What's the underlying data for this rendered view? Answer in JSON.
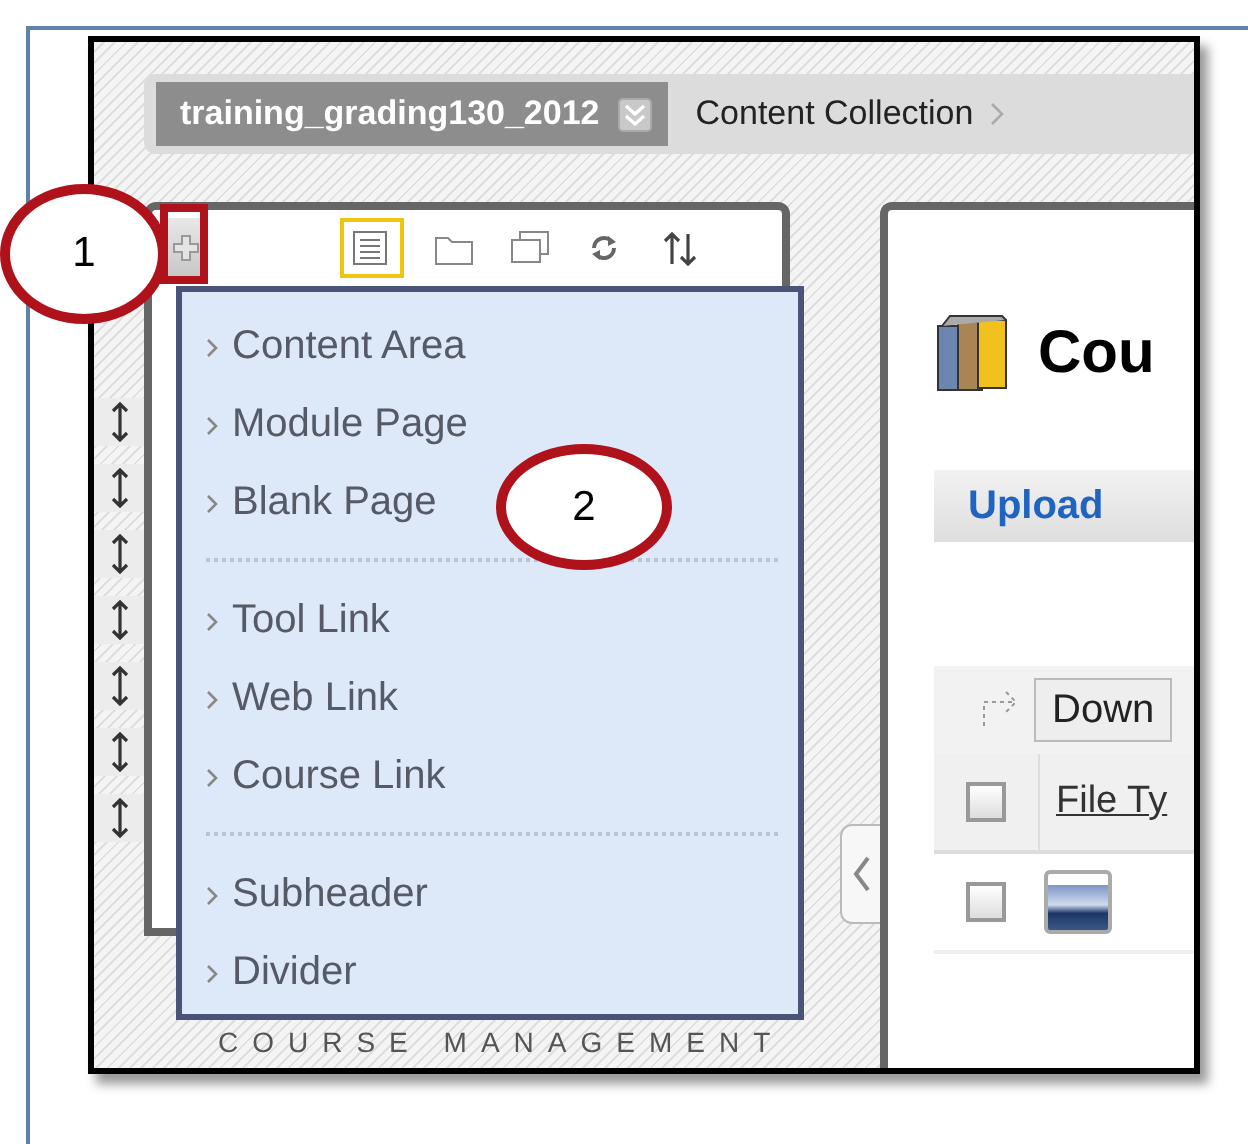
{
  "breadcrumb": {
    "course": "training_grading130_2012",
    "items": [
      {
        "label": "Content Collection"
      }
    ]
  },
  "add_menu": {
    "expanded": true,
    "groups": [
      {
        "items": [
          {
            "label": "Content Area"
          },
          {
            "label": "Module Page"
          },
          {
            "label": "Blank Page"
          }
        ]
      },
      {
        "items": [
          {
            "label": "Tool Link"
          },
          {
            "label": "Web Link"
          },
          {
            "label": "Course Link"
          }
        ]
      },
      {
        "items": [
          {
            "label": "Subheader"
          },
          {
            "label": "Divider"
          }
        ]
      }
    ]
  },
  "course_menu_footer": "COURSE MANAGEMENT",
  "content": {
    "page_title": "Cou",
    "action_bar": {
      "buttons": [
        "Upload"
      ]
    },
    "list_toolbar": {
      "button": "Down"
    },
    "table": {
      "select_all": {
        "checked": false
      },
      "columns": [
        {
          "label": "File Ty"
        }
      ],
      "rows": [
        {
          "checked": false
        }
      ]
    }
  },
  "callouts": [
    {
      "label": "1"
    },
    {
      "label": "2"
    }
  ]
}
